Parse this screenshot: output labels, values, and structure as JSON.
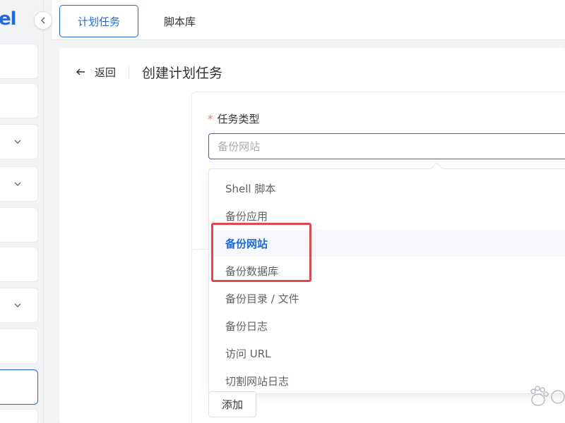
{
  "sidebar": {
    "logo_fragment": "el",
    "collapse_icon": "chevron-left-icon",
    "expand_icon": "chevron-down-icon"
  },
  "tabs": [
    {
      "label": "计划任务",
      "active": true
    },
    {
      "label": "脚本库",
      "active": false
    }
  ],
  "header": {
    "back_label": "返回",
    "back_icon": "arrow-left-icon",
    "title": "创建计划任务"
  },
  "form": {
    "task_type_label": "任务类型",
    "required_mark": "*",
    "task_type_placeholder": "备份网站"
  },
  "dropdown": {
    "options": [
      {
        "label": "Shell 脚本",
        "selected": false
      },
      {
        "label": "备份应用",
        "selected": false
      },
      {
        "label": "备份网站",
        "selected": true
      },
      {
        "label": "备份数据库",
        "selected": false
      },
      {
        "label": "备份目录 / 文件",
        "selected": false
      },
      {
        "label": "备份日志",
        "selected": false
      },
      {
        "label": "访问 URL",
        "selected": false
      },
      {
        "label": "切割网站日志",
        "selected": false
      }
    ]
  },
  "add_button_label": "添加",
  "colors": {
    "accent": "#1f6bdc",
    "annotation": "#e0484d",
    "required": "#f56c6c"
  }
}
